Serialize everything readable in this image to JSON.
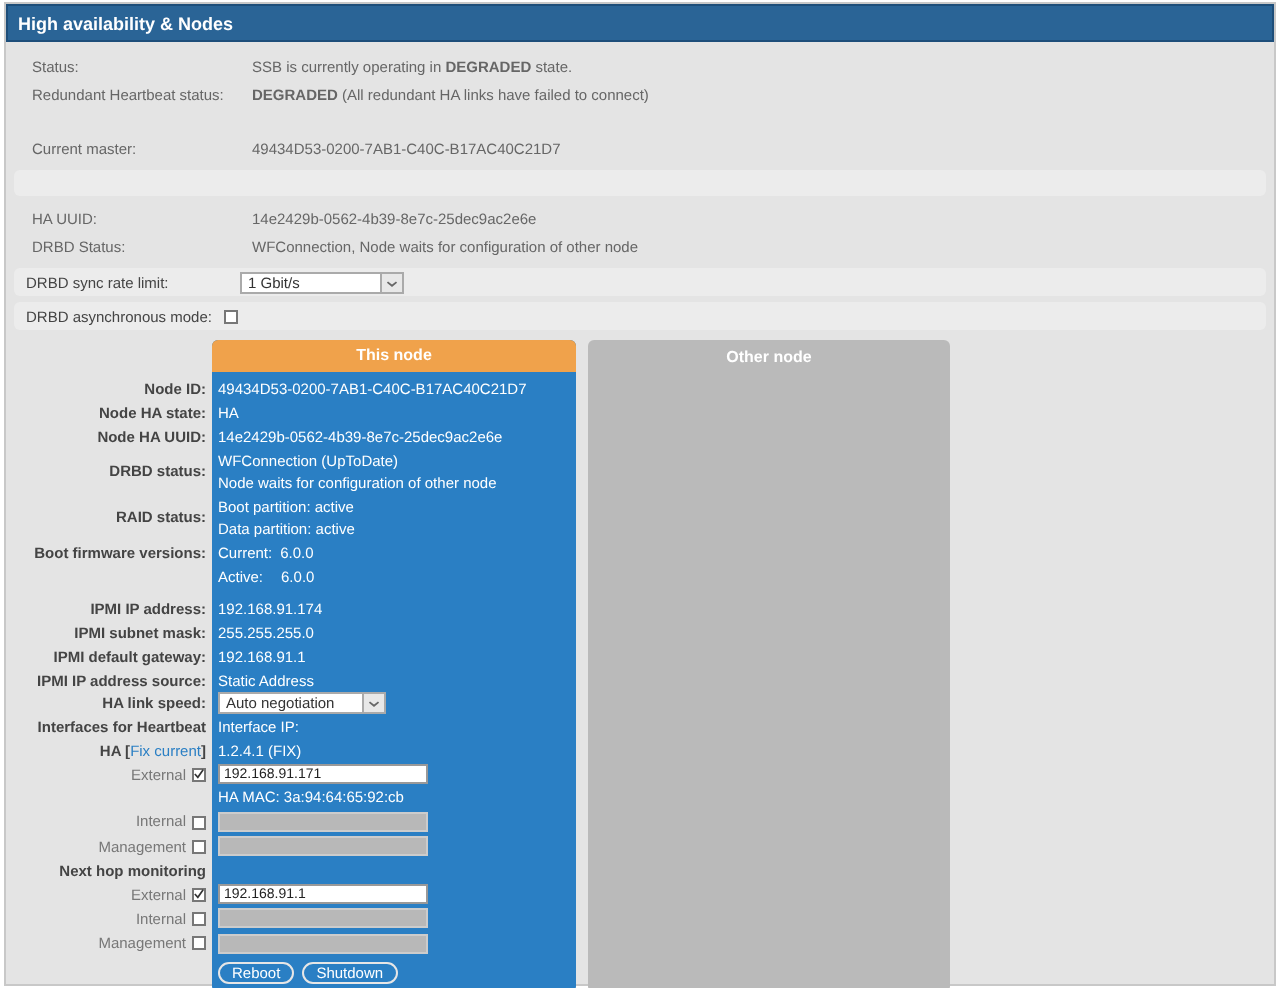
{
  "title": "High availability & Nodes",
  "status_rows": [
    {
      "kind": "text",
      "label": "Status:",
      "value": "SSB is currently operating in **DEGRADED** state."
    },
    {
      "kind": "text",
      "label": "Redundant Heartbeat status:",
      "value": "**DEGRADED** (All redundant HA links have failed to connect)"
    },
    {
      "kind": "spacer"
    },
    {
      "kind": "text",
      "label": "Current master:",
      "value": "49434D53-0200-7AB1-C40C-B17AC40C21D7"
    },
    {
      "kind": "band"
    },
    {
      "kind": "text",
      "label": "HA UUID:",
      "value": "14e2429b-0562-4b39-8e7c-25dec9ac2e6e"
    },
    {
      "kind": "text",
      "label": "DRBD Status:",
      "value": "WFConnection, Node waits for configuration of other node"
    }
  ],
  "settings": [
    {
      "kind": "select",
      "label": "DRBD sync rate limit:",
      "value": "1 Gbit/s"
    },
    {
      "kind": "checkbox",
      "label": "DRBD asynchronous mode:",
      "checked": false
    }
  ],
  "this_node": {
    "title": "This node",
    "rows": [
      {
        "kind": "info",
        "label": "Node ID:",
        "lines": [
          "49434D53-0200-7AB1-C40C-B17AC40C21D7"
        ]
      },
      {
        "kind": "info",
        "label": "Node HA state:",
        "lines": [
          "HA"
        ]
      },
      {
        "kind": "info",
        "label": "Node HA UUID:",
        "lines": [
          "14e2429b-0562-4b39-8e7c-25dec9ac2e6e"
        ]
      },
      {
        "kind": "info",
        "label": "DRBD status:",
        "lines": [
          "WFConnection (UpToDate)",
          "Node waits for configuration of other node"
        ]
      },
      {
        "kind": "info",
        "label": "RAID status:",
        "lines": [
          "Boot partition: active",
          "Data partition: active"
        ]
      },
      {
        "kind": "version",
        "label": "Boot firmware versions:",
        "name": "Current:",
        "value": "6.0.0"
      },
      {
        "kind": "version",
        "name": "Active:",
        "value": "6.0.0"
      },
      {
        "kind": "gap"
      },
      {
        "kind": "info",
        "label": "IPMI IP address:",
        "lines": [
          "192.168.91.174"
        ]
      },
      {
        "kind": "info",
        "label": "IPMI subnet mask:",
        "lines": [
          "255.255.255.0"
        ]
      },
      {
        "kind": "info",
        "label": "IPMI default gateway:",
        "lines": [
          "192.168.91.1"
        ]
      },
      {
        "kind": "info",
        "label": "IPMI IP address source:",
        "lines": [
          "Static Address"
        ]
      },
      {
        "kind": "select",
        "label": "HA link speed:",
        "value": "Auto negotiation"
      },
      {
        "kind": "info",
        "label": "Interfaces for Heartbeat",
        "lines": [
          "Interface IP:"
        ]
      },
      {
        "kind": "fix",
        "label": "HA [",
        "link": "Fix current",
        "suffix": "]",
        "value": "1.2.4.1 (FIX)"
      },
      {
        "kind": "interface",
        "label": "External",
        "checked": true,
        "value": "192.168.91.171"
      },
      {
        "kind": "note",
        "value": "HA MAC: 3a:94:64:65:92:cb"
      },
      {
        "kind": "interface",
        "label": "Internal",
        "checked": false
      },
      {
        "kind": "interface",
        "label": "Management",
        "checked": false
      },
      {
        "kind": "heading",
        "label": "Next hop monitoring"
      },
      {
        "kind": "interface",
        "label": "External",
        "checked": true,
        "value": "192.168.91.1"
      },
      {
        "kind": "interface",
        "label": "Internal",
        "checked": false
      },
      {
        "kind": "interface",
        "label": "Management",
        "checked": false
      }
    ],
    "buttons": [
      "Reboot",
      "Shutdown"
    ]
  },
  "other_node": {
    "title": "Other node"
  }
}
